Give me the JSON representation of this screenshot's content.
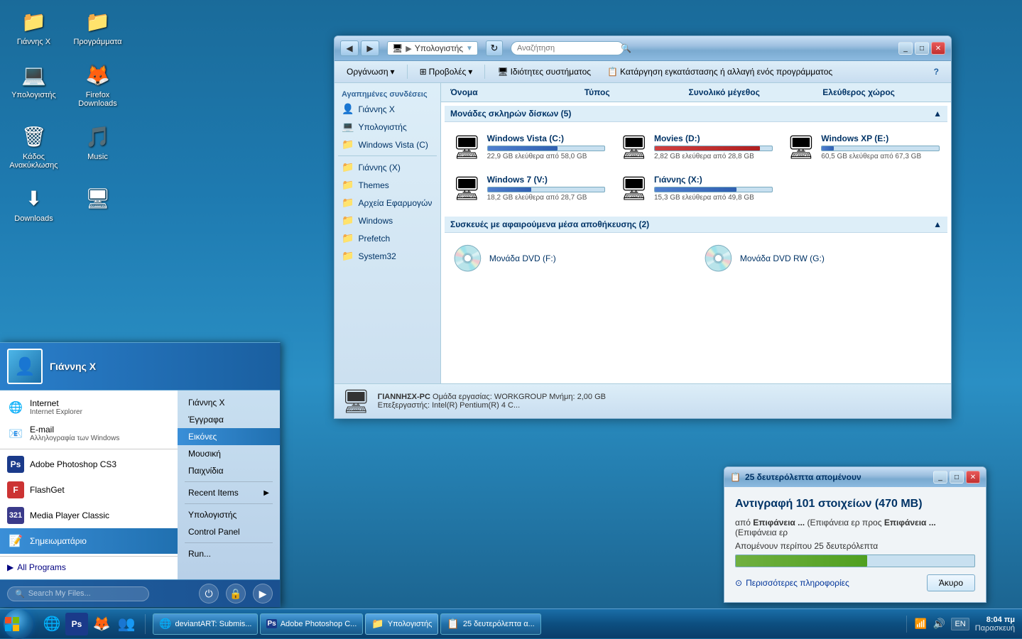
{
  "desktop": {
    "icons": [
      {
        "id": "icon-yiannis",
        "label": "Γιάννης Χ",
        "emoji": "📁"
      },
      {
        "id": "icon-programs",
        "label": "Προγράμματα",
        "emoji": "📁"
      },
      {
        "id": "icon-computer",
        "label": "Υπολογιστής",
        "emoji": "💻"
      },
      {
        "id": "icon-firefox",
        "label": "Firefox Downloads",
        "emoji": "🦊"
      },
      {
        "id": "icon-recycle",
        "label": "Κάδος Ανακύκλωσης",
        "emoji": "🗑"
      },
      {
        "id": "icon-music",
        "label": "Music",
        "emoji": "🎵"
      },
      {
        "id": "icon-downloads",
        "label": "Downloads",
        "emoji": "⬇"
      },
      {
        "id": "icon-network",
        "label": "",
        "emoji": "🖥"
      }
    ]
  },
  "start_menu": {
    "username": "Γιάννης Χ",
    "left_items": [
      {
        "icon": "🌐",
        "label": "Internet",
        "sublabel": "Internet Explorer"
      },
      {
        "icon": "📧",
        "label": "E-mail",
        "sublabel": "Αλληλογραφία των Windows"
      },
      {
        "icon": "🅿",
        "label": "Adobe Photoshop CS3",
        "sublabel": ""
      },
      {
        "icon": "📥",
        "label": "FlashGet",
        "sublabel": ""
      },
      {
        "icon": "🎬",
        "label": "Media Player Classic",
        "sublabel": ""
      },
      {
        "icon": "📝",
        "label": "Σημειωματάριο",
        "sublabel": "",
        "active": true
      }
    ],
    "right_items": [
      {
        "label": "Γιάννης Χ",
        "arrow": false
      },
      {
        "label": "Έγγραφα",
        "arrow": false
      },
      {
        "label": "Εικόνες",
        "arrow": false,
        "active": true
      },
      {
        "label": "Μουσική",
        "arrow": false
      },
      {
        "label": "Παιχνίδια",
        "arrow": false
      },
      {
        "label": "Recent Items",
        "arrow": true
      },
      {
        "label": "Υπολογιστής",
        "arrow": false
      },
      {
        "label": "Control Panel",
        "arrow": false
      },
      {
        "label": "Run...",
        "arrow": false
      }
    ],
    "all_programs": "All Programs",
    "search_placeholder": "Search My Files...",
    "controls": [
      "⏻",
      "🔒",
      "▶"
    ]
  },
  "explorer": {
    "title": "Υπολογιστής",
    "address": "Υπολογιστής",
    "search_placeholder": "Αναζήτηση",
    "toolbar_buttons": [
      "Οργάνωση ▾",
      "Προβολές ▾",
      "Ιδιότητες συστήματος",
      "Κατάργηση εγκατάστασης ή αλλαγή ενός προγράμματος"
    ],
    "columns": [
      "Όνομα",
      "Τύπος",
      "Συνολικό μέγεθος",
      "Ελεύθερος χώρος"
    ],
    "sidebar_sections": {
      "favorites_title": "Αγαπημένες συνδέσεις",
      "favorites": [
        {
          "icon": "👤",
          "label": "Γιάννης Χ"
        },
        {
          "icon": "💻",
          "label": "Υπολογιστής"
        },
        {
          "icon": "📁",
          "label": "Windows Vista (C)"
        }
      ],
      "other": [
        {
          "icon": "📁",
          "label": "Γιάννης (Χ)"
        },
        {
          "icon": "📁",
          "label": "Themes"
        },
        {
          "icon": "📁",
          "label": "Αρχεία Εφαρμογών"
        },
        {
          "icon": "📁",
          "label": "Windows"
        },
        {
          "icon": "📁",
          "label": "Prefetch"
        },
        {
          "icon": "📁",
          "label": "System32"
        }
      ]
    },
    "hdd_section": "Μονάδες σκληρών δίσκων (5)",
    "drives": [
      {
        "name": "Windows Vista (C:)",
        "free": "22,9 GB ελεύθερα από 58,0 GB",
        "fill_pct": 60
      },
      {
        "name": "Movies (D:)",
        "free": "2,82 GB ελεύθερα από 28,8 GB",
        "fill_pct": 90
      },
      {
        "name": "Windows XP (E:)",
        "free": "60,5 GB ελεύθερα από 67,3 GB",
        "fill_pct": 10
      },
      {
        "name": "Windows 7 (V:)",
        "free": "18,2 GB ελεύθερα από 28,7 GB",
        "fill_pct": 37
      },
      {
        "name": "Γιάννης (Χ:)",
        "free": "15,3 GB ελεύθερα από 49,8 GB",
        "fill_pct": 70
      }
    ],
    "removable_section": "Συσκευές με αφαιρούμενα μέσα αποθήκευσης (2)",
    "dvd_drives": [
      {
        "name": "Μονάδα DVD (F:)"
      },
      {
        "name": "Μονάδα DVD RW (G:)"
      }
    ],
    "status": {
      "pc_name": "ΓΙΑΝΝΗΣΧ-PC",
      "workgroup": "Ομάδα εργασίας: WORKGROUP",
      "memory": "Μνήμη: 2,00 GB",
      "cpu": "Επεξεργαστής: Intel(R) Pentium(R) 4 C..."
    }
  },
  "copy_dialog": {
    "title": "25 δευτερόλεπτα απομένουν",
    "heading": "Αντιγραφή 101 στοιχείων (470 MB)",
    "from_label": "από",
    "from_bold": "Επιφάνεια ...",
    "to_prefix": "(Επιφάνεια ερ προς",
    "to_bold": "Επιφάνεια ...",
    "to_suffix": "(Επιφάνεια ερ",
    "remaining": "Απομένουν περίπου 25 δευτερόλεπτα",
    "progress_pct": 55,
    "more_info": "Περισσότερες πληροφορίες",
    "cancel": "Άκυρο"
  },
  "taskbar": {
    "tasks": [
      {
        "icon": "🌐",
        "label": "deviantART: Submis..."
      },
      {
        "icon": "🅿",
        "label": "Adobe Photoshop C..."
      },
      {
        "icon": "📁",
        "label": "Υπολογιστής",
        "active": true
      },
      {
        "icon": "📋",
        "label": "25 δευτερόλεπτα α..."
      }
    ],
    "tray": {
      "lang": "EN",
      "time": "8:04 πμ",
      "date": "Παρασκευή"
    },
    "quick_launch": [
      "🌐",
      "🅿",
      "🦊",
      "👥"
    ]
  }
}
